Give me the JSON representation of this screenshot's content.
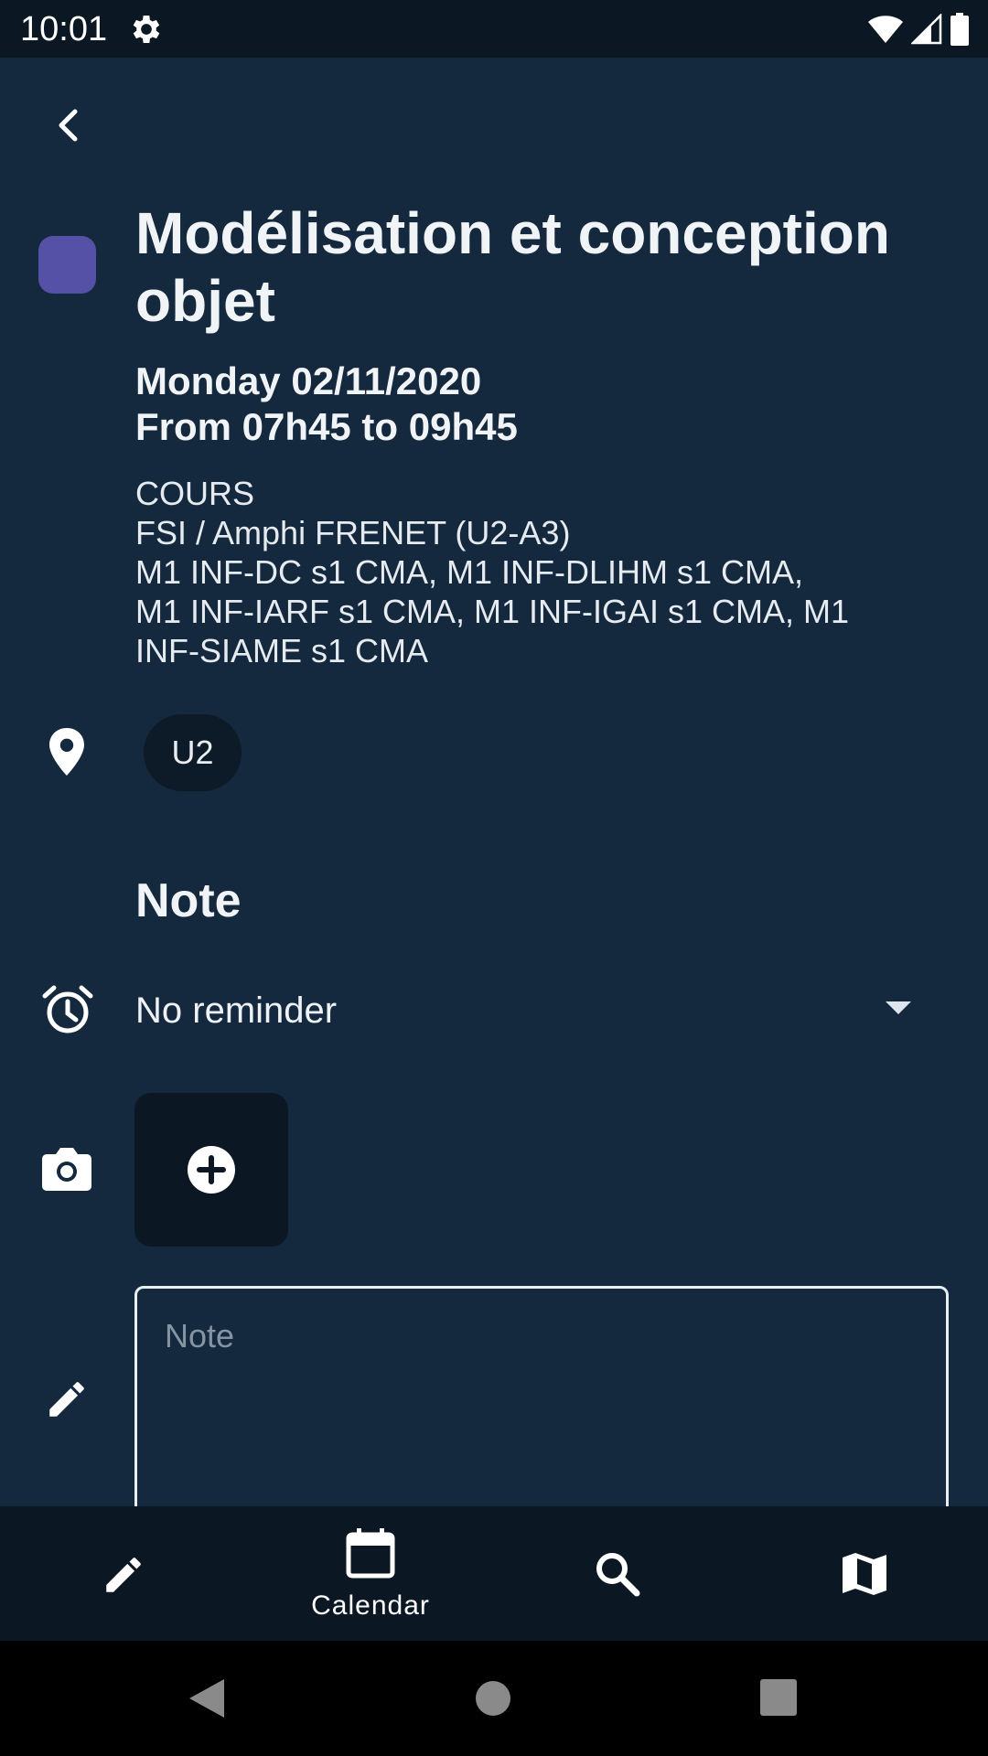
{
  "status_bar": {
    "time": "10:01",
    "icons": [
      "gear-icon",
      "wifi-icon",
      "signal-icon",
      "battery-icon"
    ]
  },
  "event": {
    "color": "#5451a6",
    "title": "Modélisation et conception objet",
    "date": "Monday 02/11/2020",
    "time_range": "From 07h45 to 09h45",
    "details": [
      "COURS",
      "FSI / Amphi FRENET (U2-A3)",
      "M1 INF-DC s1 CMA, M1 INF-DLIHM s1 CMA,",
      "M1 INF-IARF s1 CMA, M1 INF-IGAI s1 CMA, M1",
      "INF-SIAME s1 CMA"
    ],
    "location_chip": "U2"
  },
  "note_section": {
    "title": "Note",
    "reminder": "No reminder",
    "note_placeholder": "Note",
    "note_value": ""
  },
  "bottom_nav": {
    "items": [
      {
        "icon": "pencil-icon",
        "label": ""
      },
      {
        "icon": "calendar-icon",
        "label": "Calendar"
      },
      {
        "icon": "search-icon",
        "label": ""
      },
      {
        "icon": "map-icon",
        "label": ""
      }
    ],
    "active": "Calendar"
  },
  "colors": {
    "background": "#14283e",
    "bars": "#0b1824",
    "text": "#eef2f6"
  }
}
